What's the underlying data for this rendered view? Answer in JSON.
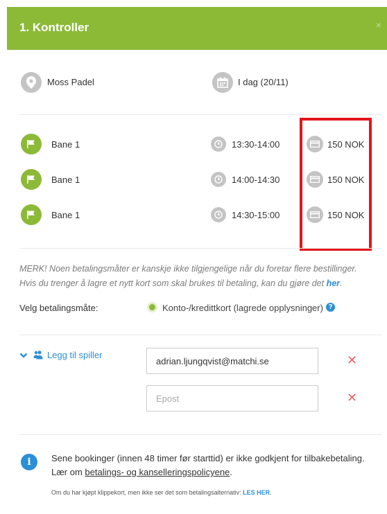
{
  "header": {
    "title": "1. Kontroller",
    "close": "×"
  },
  "venue": {
    "name": "Moss Padel",
    "date": "I dag (20/11)"
  },
  "bookings": [
    {
      "court": "Bane 1",
      "time": "13:30-14:00",
      "price": "150 NOK"
    },
    {
      "court": "Bane 1",
      "time": "14:00-14:30",
      "price": "150 NOK"
    },
    {
      "court": "Bane 1",
      "time": "14:30-15:00",
      "price": "150 NOK"
    }
  ],
  "note": {
    "line1": "MERK! Noen betalingsmåter er kanskje ikke tilgjengelige når du foretar flere bestillinger.",
    "line2": "Hvis du trenger å lagre et nytt kort som skal brukes til betaling, kan du gjøre det",
    "link": "her",
    "end": "."
  },
  "payment": {
    "label": "Velg betalingsmåte:",
    "option": "Konto-/kredittkort (lagrede opplysninger)",
    "help": "?"
  },
  "players": {
    "add_label": "Legg til spiller",
    "email_value": "adrian.ljungqvist@matchi.se",
    "email_placeholder": "Epost",
    "remove": "✕"
  },
  "info": {
    "text1": "Sene bookinger (innen 48 timer før starttid) er ikke godkjent for tilbakebetaling.",
    "text2": "Lær om",
    "link": "betalings- og kanselleringspolicyene",
    "end": ".",
    "footnote": "Om du har kjøpt klippekort, men ikke ser det som betalingsalternativ:",
    "footnote_link": "LES HER",
    "footnote_end": "."
  },
  "colors": {
    "brand_green": "#8cba37",
    "link_blue": "#2d8fd6",
    "highlight_red": "#e3151a",
    "remove_red": "#e8646a"
  }
}
